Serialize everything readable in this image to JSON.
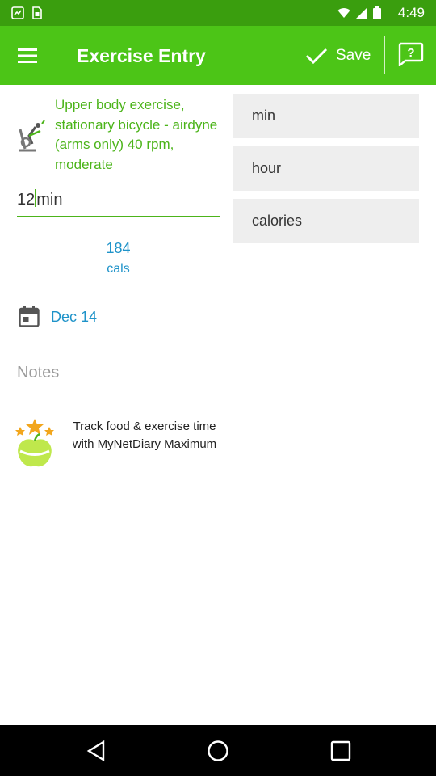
{
  "status_bar": {
    "time": "4:49"
  },
  "app_bar": {
    "title": "Exercise Entry",
    "save_label": "Save",
    "menu_icon": "hamburger-menu-icon",
    "help_icon": "help-chat-icon"
  },
  "exercise": {
    "name": "Upper body exercise, stationary bicycle - airdyne (arms only) 40 rpm, moderate",
    "icon": "stationary-bike-icon",
    "duration_value": "12min"
  },
  "units": [
    {
      "label": "min"
    },
    {
      "label": "hour"
    },
    {
      "label": "calories"
    }
  ],
  "calories": {
    "value": "184",
    "unit": "cals"
  },
  "date": {
    "label": "Dec 14",
    "icon": "calendar-icon"
  },
  "notes": {
    "placeholder": "Notes",
    "value": ""
  },
  "promo": {
    "text": "Track food & exercise time with MyNetDiary Maximum"
  },
  "colors": {
    "app_bar": "#4cc517",
    "status_bar": "#3a9e0e",
    "accent_green": "#4cb41a",
    "accent_blue": "#1f93c9",
    "unit_button_bg": "#eeeeee"
  }
}
